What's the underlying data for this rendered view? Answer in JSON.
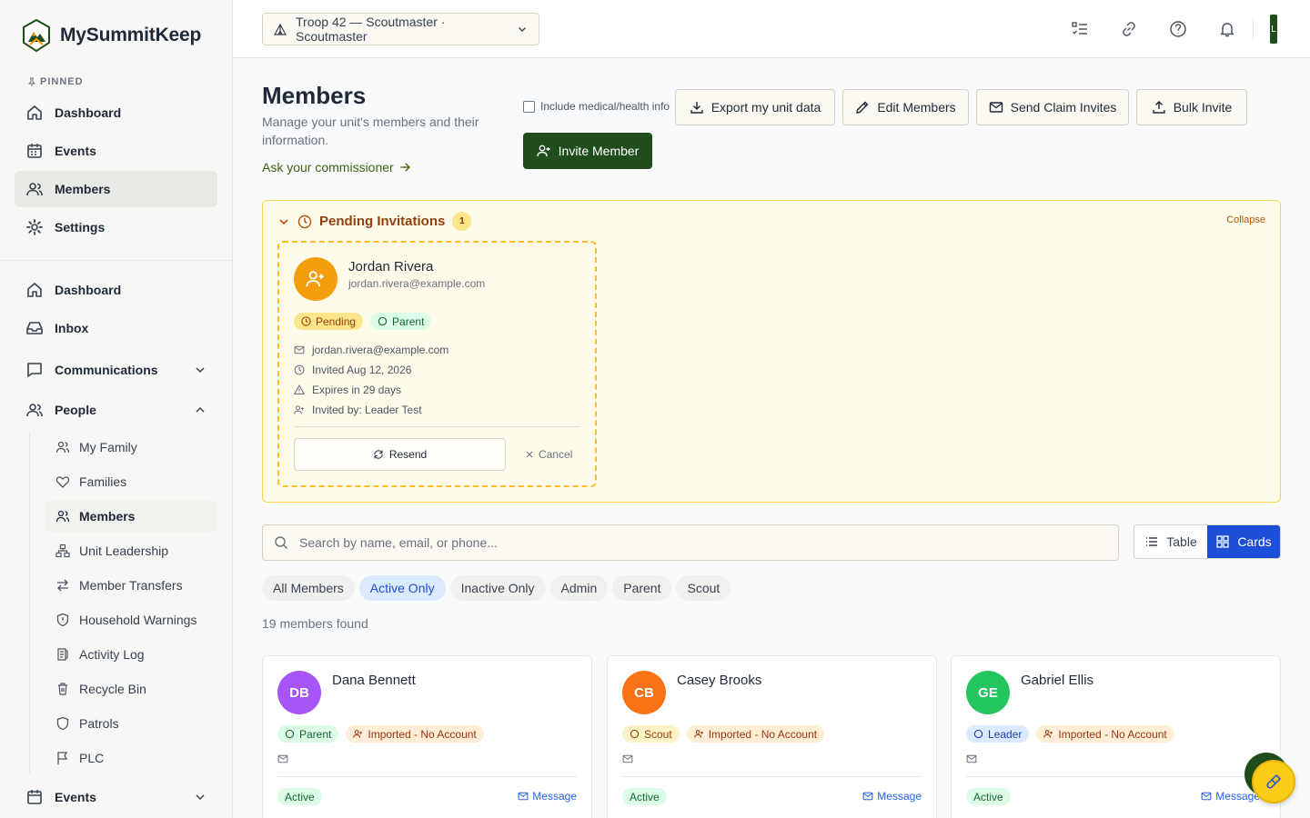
{
  "brand": {
    "name": "MySummitKeep"
  },
  "sidebar": {
    "pinned_label": "PINNED",
    "pinned": [
      {
        "label": "Dashboard",
        "icon": "home-icon"
      },
      {
        "label": "Events",
        "icon": "calendar-icon"
      },
      {
        "label": "Members",
        "icon": "users-icon",
        "active": true
      },
      {
        "label": "Settings",
        "icon": "gear-icon"
      }
    ],
    "main": [
      {
        "label": "Dashboard",
        "icon": "home-icon"
      },
      {
        "label": "Inbox",
        "icon": "inbox-icon"
      },
      {
        "label": "Communications",
        "icon": "message-icon",
        "expandable": true
      },
      {
        "label": "People",
        "icon": "users-icon",
        "expanded": true
      }
    ],
    "people_sub": [
      {
        "label": "My Family",
        "icon": "user-pair-icon"
      },
      {
        "label": "Families",
        "icon": "heart-icon"
      },
      {
        "label": "Members",
        "icon": "users-icon",
        "active": true
      },
      {
        "label": "Unit Leadership",
        "icon": "org-chart-icon"
      },
      {
        "label": "Member Transfers",
        "icon": "transfer-icon"
      },
      {
        "label": "Household Warnings",
        "icon": "shield-alert-icon"
      },
      {
        "label": "Activity Log",
        "icon": "log-icon"
      },
      {
        "label": "Recycle Bin",
        "icon": "trash-icon"
      },
      {
        "label": "Patrols",
        "icon": "shield-icon"
      },
      {
        "label": "PLC",
        "icon": "flag-icon"
      }
    ],
    "events_label": "Events"
  },
  "topbar": {
    "troop_selector": "Troop 42 — Scoutmaster · Scoutmaster",
    "avatar_initial": "L"
  },
  "page": {
    "title": "Members",
    "subtitle": "Manage your unit's members and their information.",
    "ask_link": "Ask your commissioner",
    "include_medical": "Include medical/health info",
    "buttons": {
      "export": "Export my unit data",
      "edit": "Edit Members",
      "claim": "Send Claim Invites",
      "bulk": "Bulk Invite",
      "invite": "Invite Member"
    }
  },
  "pending": {
    "title": "Pending Invitations",
    "count": "1",
    "collapse": "Collapse",
    "invite": {
      "name": "Jordan Rivera",
      "email": "jordan.rivera@example.com",
      "status": "Pending",
      "role": "Parent",
      "meta_email": "jordan.rivera@example.com",
      "invited": "Invited Aug 12, 2026",
      "expires": "Expires in 29 days",
      "invited_by": "Invited by: Leader Test",
      "resend": "Resend",
      "cancel": "Cancel"
    }
  },
  "search": {
    "placeholder": "Search by name, email, or phone..."
  },
  "view": {
    "table": "Table",
    "cards": "Cards",
    "selected": "Cards"
  },
  "filters": [
    {
      "label": "All Members"
    },
    {
      "label": "Active Only",
      "active": true
    },
    {
      "label": "Inactive Only"
    },
    {
      "label": "Admin"
    },
    {
      "label": "Parent"
    },
    {
      "label": "Scout"
    }
  ],
  "found_text": "19 members found",
  "members": [
    {
      "initials": "DB",
      "name": "Dana Bennett",
      "color": "#a855f7",
      "role": "Parent",
      "role_style": "green",
      "account": "Imported - No Account",
      "status": "Active",
      "message": "Message"
    },
    {
      "initials": "CB",
      "name": "Casey Brooks",
      "color": "#f97316",
      "role": "Scout",
      "role_style": "yellow",
      "account": "Imported - No Account",
      "status": "Active",
      "message": "Message"
    },
    {
      "initials": "GE",
      "name": "Gabriel Ellis",
      "color": "#22c55e",
      "role": "Leader",
      "role_style": "blue",
      "account": "Imported - No Account",
      "status": "Active",
      "message": "Message"
    }
  ],
  "colors": {
    "brand_green": "#1f4d1c",
    "accent_blue": "#1d4ed8",
    "pending_amber": "#fcd34d"
  }
}
